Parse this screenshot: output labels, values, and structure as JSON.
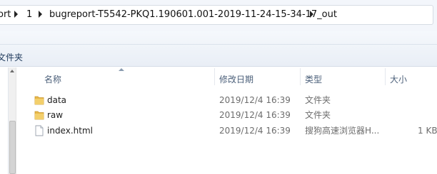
{
  "address": {
    "crumbs": [
      "ort",
      "1",
      "bugreport-T5542-PKQ1.190601.001-2019-11-24-15-34-17_out"
    ]
  },
  "toolbar": {
    "new_folder_label": "文件夹"
  },
  "columns": {
    "name": "名称",
    "modified": "修改日期",
    "type": "类型",
    "size": "大小"
  },
  "files": [
    {
      "name": "data",
      "modified": "2019/12/4 16:39",
      "type": "文件夹",
      "size": "",
      "icon": "folder-icon"
    },
    {
      "name": "raw",
      "modified": "2019/12/4 16:39",
      "type": "文件夹",
      "size": "",
      "icon": "folder-icon"
    },
    {
      "name": "index.html",
      "modified": "2019/12/4 16:39",
      "type": "搜狗高速浏览器H...",
      "size": "1 KB",
      "icon": "html-file-icon"
    }
  ],
  "colors": {
    "folder": "#e8b84a",
    "header_text": "#4c607a",
    "meta_text": "#6d6d6d"
  }
}
